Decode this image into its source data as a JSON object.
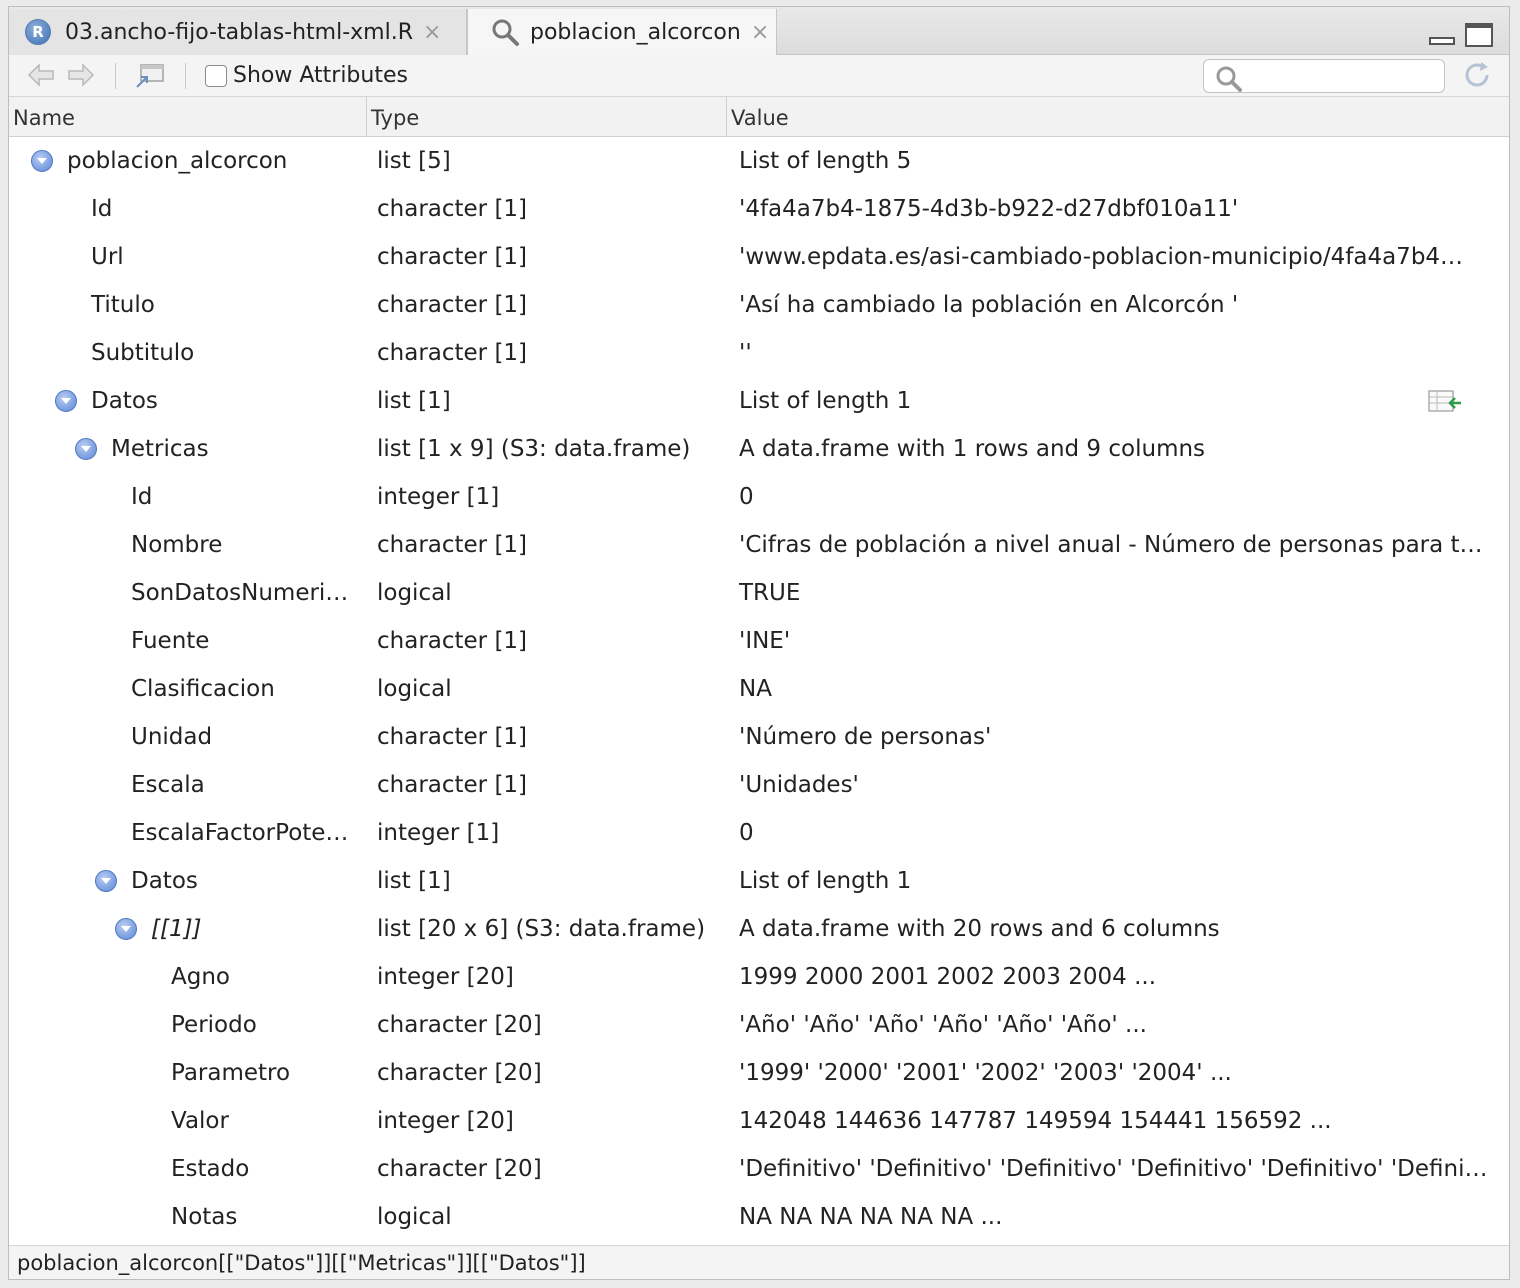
{
  "tabs": [
    {
      "label": "03.ancho-fijo-tablas-html-xml.R",
      "icon": "r-file-icon"
    },
    {
      "label": "poblacion_alcorcon",
      "icon": "search-icon"
    }
  ],
  "toolbar": {
    "show_attributes_label": "Show Attributes",
    "search_placeholder": ""
  },
  "columns": {
    "name": "Name",
    "type": "Type",
    "value": "Value"
  },
  "rows": [
    {
      "name": "poblacion_alcorcon",
      "type": "list [5]",
      "value": "List of length 5"
    },
    {
      "name": "Id",
      "type": "character [1]",
      "value": "'4fa4a7b4-1875-4d3b-b922-d27dbf010a11'"
    },
    {
      "name": "Url",
      "type": "character [1]",
      "value": "'www.epdata.es/asi-cambiado-poblacion-municipio/4fa4a7b4…"
    },
    {
      "name": "Titulo",
      "type": "character [1]",
      "value": "'Así ha cambiado la población en Alcorcón '"
    },
    {
      "name": "Subtitulo",
      "type": "character [1]",
      "value": "''"
    },
    {
      "name": "Datos",
      "type": "list [1]",
      "value": "List of length 1"
    },
    {
      "name": "Metricas",
      "type": "list [1 x 9] (S3: data.frame)",
      "value": "A data.frame with 1 rows and 9 columns"
    },
    {
      "name": "Id",
      "type": "integer [1]",
      "value": "0"
    },
    {
      "name": "Nombre",
      "type": "character [1]",
      "value": "'Cifras de población a nivel anual - Número de personas para t…"
    },
    {
      "name": "SonDatosNumeri…",
      "type": "logical",
      "value": "TRUE"
    },
    {
      "name": "Fuente",
      "type": "character [1]",
      "value": "'INE'"
    },
    {
      "name": "Clasificacion",
      "type": "logical",
      "value": "NA"
    },
    {
      "name": "Unidad",
      "type": "character [1]",
      "value": "'Número de personas'"
    },
    {
      "name": "Escala",
      "type": "character [1]",
      "value": "'Unidades'"
    },
    {
      "name": "EscalaFactorPote…",
      "type": "integer [1]",
      "value": "0"
    },
    {
      "name": "Datos",
      "type": "list [1]",
      "value": "List of length 1"
    },
    {
      "name": "[[1]]",
      "type": "list [20 x 6] (S3: data.frame)",
      "value": "A data.frame with 20 rows and 6 columns"
    },
    {
      "name": "Agno",
      "type": "integer [20]",
      "value": "1999 2000 2001 2002 2003 2004 ..."
    },
    {
      "name": "Periodo",
      "type": "character [20]",
      "value": "'Año' 'Año' 'Año' 'Año' 'Año' 'Año' ..."
    },
    {
      "name": "Parametro",
      "type": "character [20]",
      "value": "'1999' '2000' '2001' '2002' '2003' '2004' ..."
    },
    {
      "name": "Valor",
      "type": "integer [20]",
      "value": "142048 144636 147787 149594 154441 156592 ..."
    },
    {
      "name": "Estado",
      "type": "character [20]",
      "value": "'Definitivo' 'Definitivo' 'Definitivo' 'Definitivo' 'Definitivo' 'Definit…"
    },
    {
      "name": "Notas",
      "type": "logical",
      "value": "NA NA NA NA NA NA ..."
    }
  ],
  "status": {
    "path": "poblacion_alcorcon[[\"Datos\"]][[\"Metricas\"]][[\"Datos\"]]"
  }
}
